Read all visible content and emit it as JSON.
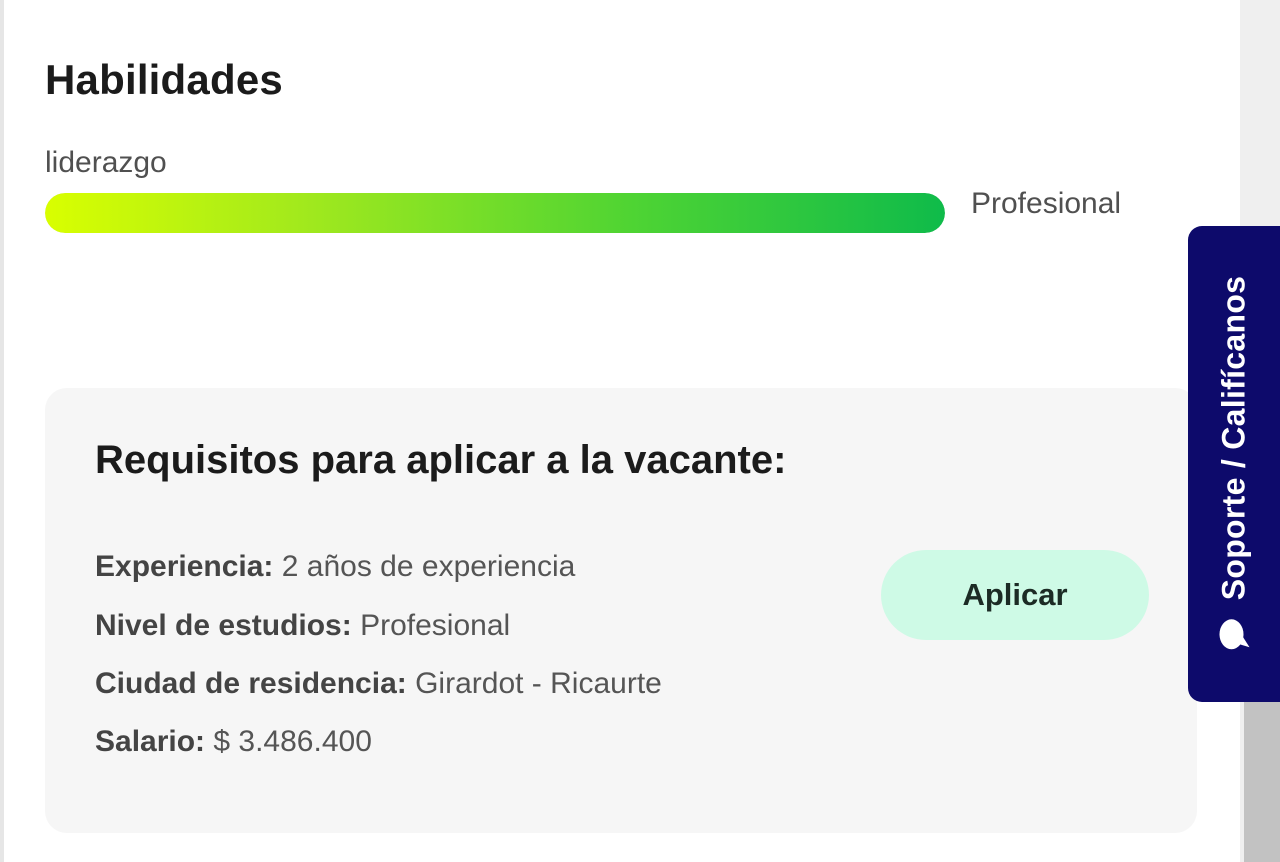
{
  "skills": {
    "title": "Habilidades",
    "items": [
      {
        "name": "liderazgo",
        "level": "Profesional",
        "fill_fraction": 1.0
      }
    ]
  },
  "requirements": {
    "title": "Requisitos para aplicar a la vacante:",
    "rows": [
      {
        "label": "Experiencia:",
        "value": "2 años de experiencia"
      },
      {
        "label": "Nivel de estudios:",
        "value": "Profesional"
      },
      {
        "label": "Ciudad de residencia:",
        "value": "Girardot - Ricaurte"
      },
      {
        "label": "Salario:",
        "value": "$ 3.486.400"
      }
    ],
    "apply_label": "Aplicar"
  },
  "support_tab": {
    "label": "Soporte / Califícanos",
    "icon": "chat-bubble-icon"
  },
  "colors": {
    "support_tab_bg": "#0d0a6b",
    "apply_button_bg": "#cefae6",
    "bar_gradient_start": "#d9ff00",
    "bar_gradient_end": "#0fbb4a"
  }
}
